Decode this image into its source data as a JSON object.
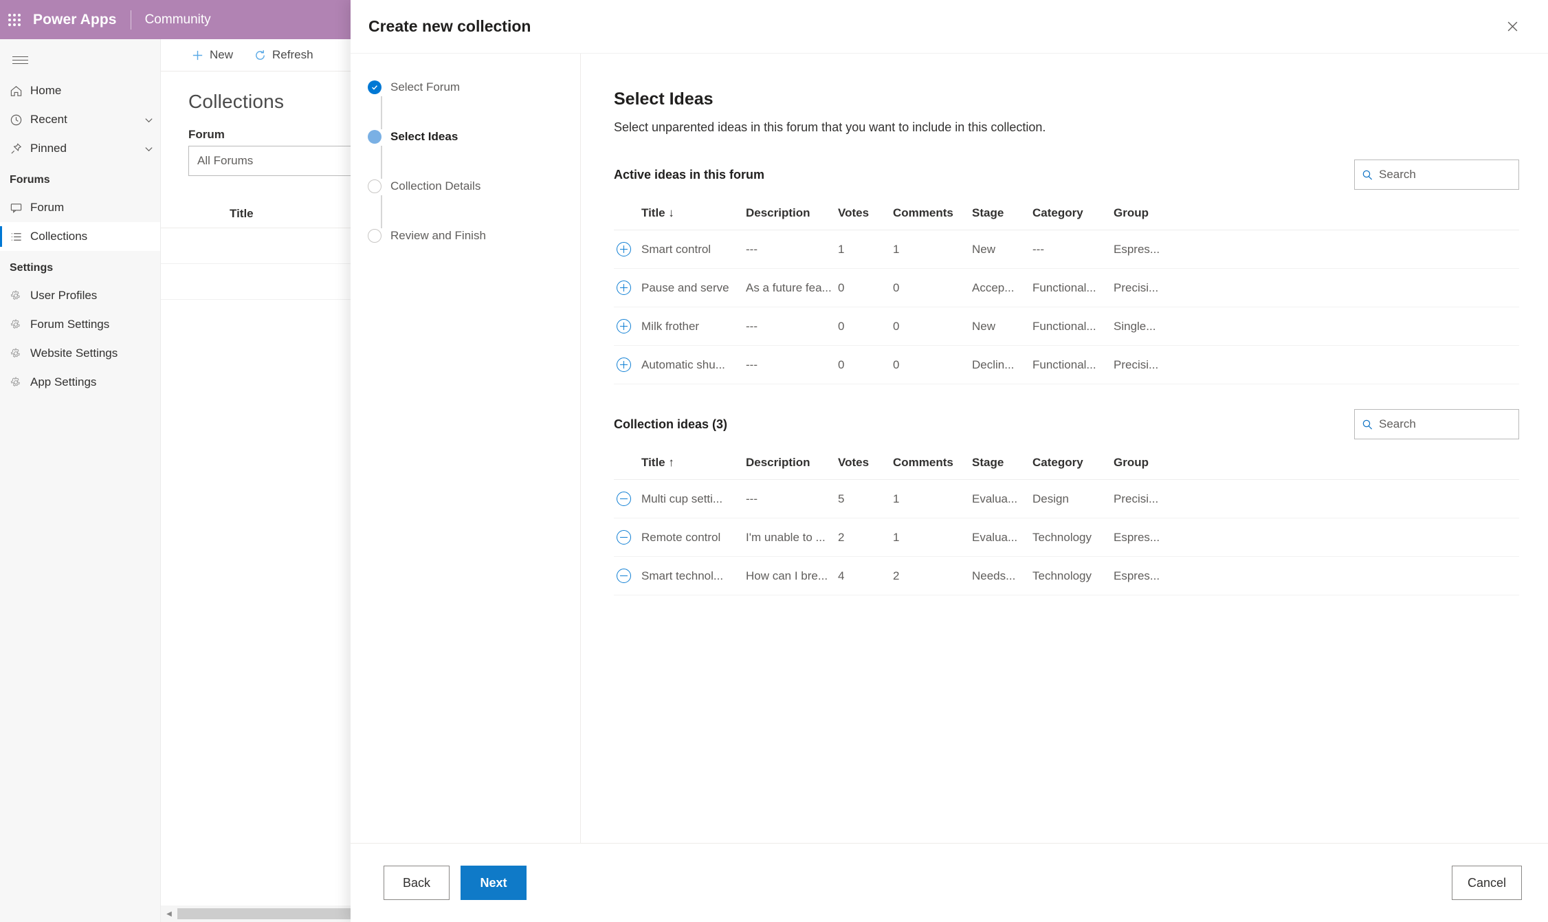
{
  "topbar": {
    "waffle_icon": "app-launcher-icon",
    "brand": "Power Apps",
    "app_name": "Community",
    "brand_color": "#b183b3"
  },
  "sidebar": {
    "hamburger_icon": "hamburger-icon",
    "items": [
      {
        "label": "Home",
        "icon": "home-icon",
        "expandable": false,
        "selected": false
      },
      {
        "label": "Recent",
        "icon": "clock-icon",
        "expandable": true,
        "selected": false
      },
      {
        "label": "Pinned",
        "icon": "pin-icon",
        "expandable": true,
        "selected": false
      }
    ],
    "groups": [
      {
        "title": "Forums",
        "items": [
          {
            "label": "Forum",
            "icon": "forum-icon",
            "selected": false
          },
          {
            "label": "Collections",
            "icon": "list-icon",
            "selected": true
          }
        ]
      },
      {
        "title": "Settings",
        "items": [
          {
            "label": "User Profiles",
            "icon": "gear-icon",
            "selected": false
          },
          {
            "label": "Forum Settings",
            "icon": "gear-icon",
            "selected": false
          },
          {
            "label": "Website Settings",
            "icon": "gear-icon",
            "selected": false
          },
          {
            "label": "App Settings",
            "icon": "gear-icon",
            "selected": false
          }
        ]
      }
    ]
  },
  "background_page": {
    "commands": [
      {
        "label": "New",
        "icon": "plus-icon"
      },
      {
        "label": "Refresh",
        "icon": "refresh-icon"
      }
    ],
    "page_title": "Collections",
    "forum_field_label": "Forum",
    "forum_value": "All Forums",
    "table_header_title": "Title"
  },
  "dialog": {
    "title": "Create new collection",
    "close_icon": "close-icon",
    "steps": [
      {
        "label": "Select Forum",
        "state": "done"
      },
      {
        "label": "Select Ideas",
        "state": "current"
      },
      {
        "label": "Collection Details",
        "state": "todo"
      },
      {
        "label": "Review and Finish",
        "state": "todo"
      }
    ],
    "pane": {
      "title": "Select Ideas",
      "description": "Select unparented ideas in this forum that you want to include in this collection."
    },
    "columns": [
      "Title",
      "Description",
      "Votes",
      "Comments",
      "Stage",
      "Category",
      "Group"
    ],
    "active_section": {
      "title": "Active ideas in this forum",
      "search_placeholder": "Search",
      "search_icon": "search-icon",
      "sort_column": "Title",
      "sort_indicator": "↓",
      "row_action_icon": "add-circle-icon",
      "rows": [
        {
          "title": "Smart control",
          "description": "---",
          "votes": "1",
          "comments": "1",
          "stage": "New",
          "category": "---",
          "group": "Espres..."
        },
        {
          "title": "Pause and serve",
          "description": "As a future fea...",
          "votes": "0",
          "comments": "0",
          "stage": "Accep...",
          "category": "Functional...",
          "group": "Precisi..."
        },
        {
          "title": "Milk frother",
          "description": "---",
          "votes": "0",
          "comments": "0",
          "stage": "New",
          "category": "Functional...",
          "group": "Single..."
        },
        {
          "title": "Automatic shu...",
          "description": "---",
          "votes": "0",
          "comments": "0",
          "stage": "Declin...",
          "category": "Functional...",
          "group": "Precisi..."
        }
      ]
    },
    "collection_section": {
      "title": "Collection ideas (3)",
      "search_placeholder": "Search",
      "search_icon": "search-icon",
      "sort_column": "Title",
      "sort_indicator": "↑",
      "row_action_icon": "remove-circle-icon",
      "rows": [
        {
          "title": "Multi cup setti...",
          "description": "---",
          "votes": "5",
          "comments": "1",
          "stage": "Evalua...",
          "category": "Design",
          "group": "Precisi..."
        },
        {
          "title": "Remote control",
          "description": "I'm unable to ...",
          "votes": "2",
          "comments": "1",
          "stage": "Evalua...",
          "category": "Technology",
          "group": "Espres..."
        },
        {
          "title": "Smart technol...",
          "description": "How can I bre...",
          "votes": "4",
          "comments": "2",
          "stage": "Needs...",
          "category": "Technology",
          "group": "Espres..."
        }
      ]
    },
    "footer": {
      "back_label": "Back",
      "next_label": "Next",
      "cancel_label": "Cancel",
      "primary_color": "#0f7ac8"
    }
  }
}
